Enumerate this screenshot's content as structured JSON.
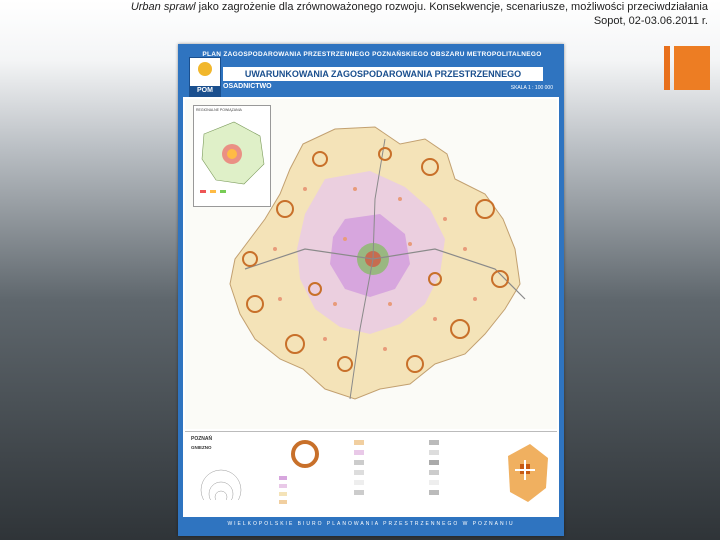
{
  "header": {
    "italic": "Urban sprawl",
    "rest": " jako zagrożenie dla zrównoważonego rozwoju. Konsekwencje, scenariusze, możliwości przeciwdziałania",
    "line2": "Sopot, 02-03.06.2011 r."
  },
  "poster": {
    "plan_title": "PLAN ZAGOSPODAROWANIA PRZESTRZENNEGO POZNAŃSKIEGO OBSZARU METROPOLITALNEGO",
    "logo_text": "POM",
    "main_title": "UWARUNKOWANIA ZAGOSPODAROWANIA PRZESTRZENNEGO",
    "sub_title": "OSADNICTWO",
    "scale": "SKALA 1 : 100 000",
    "inset_title": "REGIONALNE POWIĄZANIA",
    "footer": "WIELKOPOLSKIE BIURO PLANOWANIA PRZESTRZENNEGO W POZNANIU",
    "legend_main": "POZNAŃ",
    "legend_sub": "GNIEZNO"
  },
  "colors": {
    "accent_orange": "#ed7d23",
    "poster_blue": "#2f74c0"
  }
}
